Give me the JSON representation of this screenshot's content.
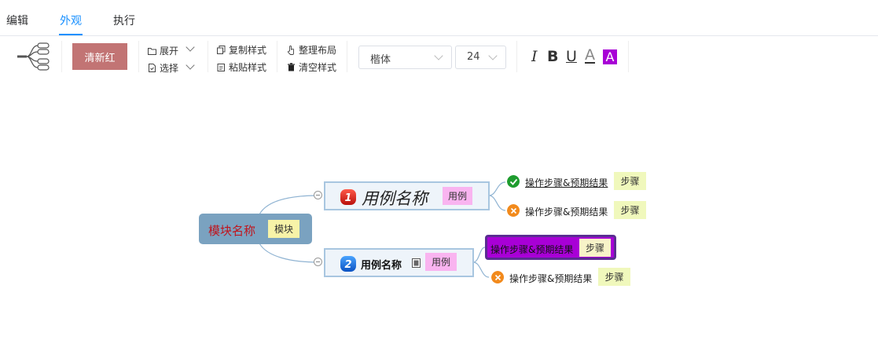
{
  "tabs": [
    "编辑",
    "外观",
    "执行"
  ],
  "toolbar": {
    "theme_label": "清新红",
    "expand_label": "展开",
    "select_label": "选择",
    "copy_style_label": "复制样式",
    "paste_style_label": "粘贴样式",
    "arrange_layout_label": "整理布局",
    "clear_style_label": "清空样式",
    "font_family": "楷体",
    "font_size": "24",
    "italic_label": "I",
    "bold_label": "B",
    "underline_label": "U",
    "font_color_label": "A",
    "bg_color_label": "A",
    "colors": {
      "theme": "#c27474",
      "font_color_bar": "#333333",
      "bg_color": "#a800d6"
    }
  },
  "mindmap": {
    "root": {
      "label": "模块名称",
      "tag": "模块",
      "color": "#7aa2c0",
      "text_color": "#c0141c"
    },
    "cases": [
      {
        "priority": "1",
        "label": "用例名称",
        "tag": "用例",
        "steps": [
          {
            "text": "操作步骤&预期结果",
            "tag": "步骤",
            "status": "pass"
          },
          {
            "text": "操作步骤&预期结果",
            "tag": "步骤",
            "status": "fail"
          }
        ]
      },
      {
        "priority": "2",
        "label": "用例名称",
        "tag": "用例",
        "steps": [
          {
            "text": "操作步骤&预期结果",
            "tag": "步骤",
            "status": "selected"
          },
          {
            "text": "操作步骤&预期结果",
            "tag": "步骤",
            "status": "fail"
          }
        ]
      }
    ]
  }
}
